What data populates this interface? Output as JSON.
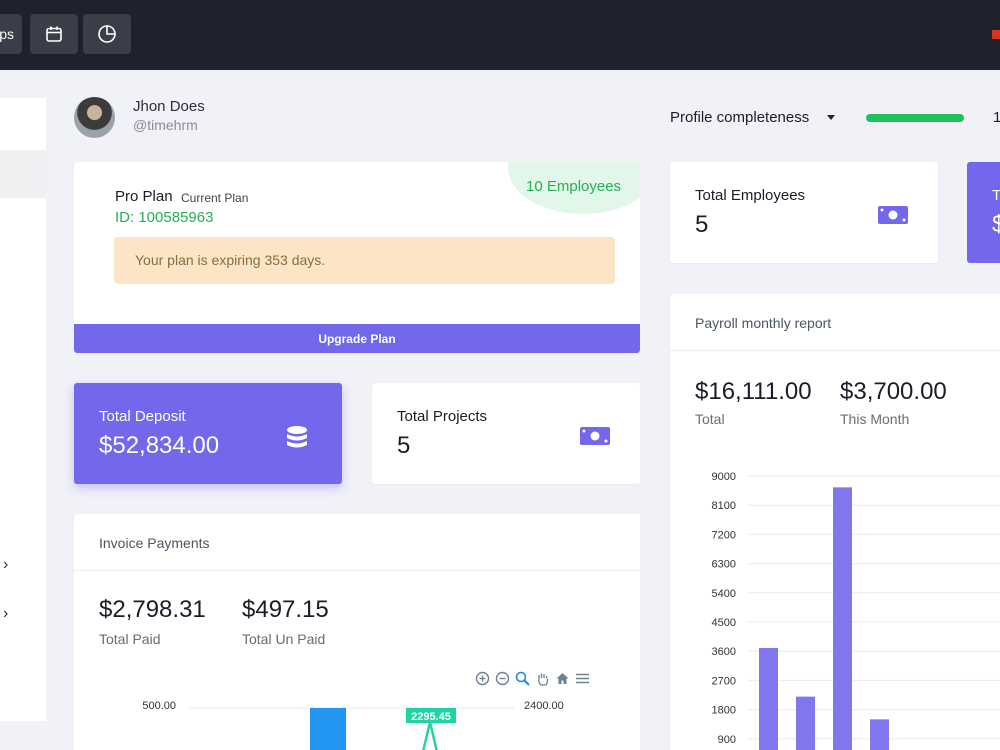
{
  "topbar": {
    "partial_label": "ps",
    "buttons": [
      "calendar-icon",
      "pie-chart-icon"
    ],
    "colors": {
      "bg": "#1e222d",
      "button": "#393e48"
    }
  },
  "user": {
    "name": "Jhon Does",
    "handle": "@timehrm"
  },
  "profile": {
    "label": "Profile completeness",
    "progress": 1.0,
    "value_partial": "1"
  },
  "plan": {
    "name": "Pro Plan",
    "current_label": "Current Plan",
    "id_text": "ID: 100585963",
    "employees_badge": "10 Employees",
    "alert": "Your plan is expiring 353 days.",
    "upgrade_label": "Upgrade Plan"
  },
  "stats": {
    "total_deposit": {
      "label": "Total Deposit",
      "value": "$52,834.00"
    },
    "total_projects": {
      "label": "Total Projects",
      "value": "5"
    },
    "total_employees": {
      "label": "Total Employees",
      "value": "5"
    },
    "partial_card": {
      "label": "T",
      "value": "$"
    }
  },
  "invoice": {
    "title": "Invoice Payments",
    "paid_value": "$2,798.31",
    "paid_label": "Total Paid",
    "unpaid_value": "$497.15",
    "unpaid_label": "Total Un Paid"
  },
  "payroll": {
    "title": "Payroll monthly report",
    "total_value": "$16,111.00",
    "total_label": "Total",
    "month_value": "$3,700.00",
    "month_label": "This Month"
  },
  "colors": {
    "accent": "#7367ec",
    "success": "#20c05c",
    "warning_bg": "#fce4c6"
  },
  "chart_data": [
    {
      "type": "bar",
      "title": "",
      "ylabel": "",
      "ylim": [
        0,
        9000
      ],
      "yticks": [
        "9000",
        "8100",
        "7200",
        "6300",
        "5400",
        "4500",
        "3600",
        "2700",
        "1800",
        "900"
      ],
      "series": [
        {
          "values": [
            3700,
            2200,
            8650,
            1500
          ]
        }
      ],
      "color": "#8276ee"
    },
    {
      "type": "bar",
      "title": "",
      "left_tick": "500.00",
      "right_tick": "2400.00",
      "annotation": "2295.45",
      "series": [
        {
          "values": [
            2295.45
          ]
        }
      ],
      "colors": {
        "bar": "#2196f3",
        "line": "#21d4a6"
      }
    }
  ]
}
